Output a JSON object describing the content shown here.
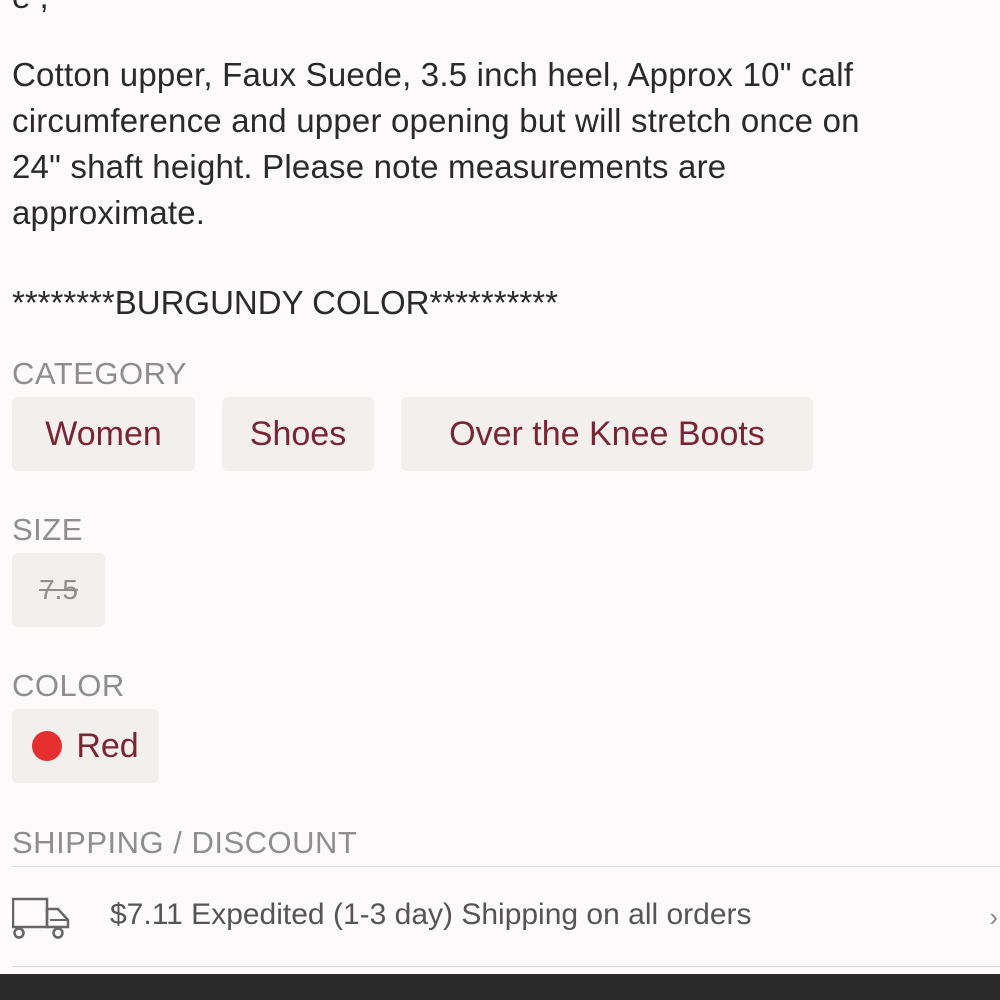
{
  "description": {
    "partial_line": "e  ,",
    "lines": [
      "Cotton upper, Faux Suede, 3.5 inch heel, Approx 10\" calf",
      "circumference and upper opening but will stretch once on",
      "24\" shaft height. Please note measurements are",
      "approximate."
    ],
    "highlight": "********BURGUNDY COLOR**********"
  },
  "category": {
    "label": "CATEGORY",
    "items": [
      "Women",
      "Shoes",
      "Over the Knee Boots"
    ]
  },
  "size": {
    "label": "SIZE",
    "value": "7.5"
  },
  "color": {
    "label": "COLOR",
    "value": "Red",
    "swatch": "#e53030"
  },
  "shipping": {
    "label": "SHIPPING / DISCOUNT",
    "text": "$7.11 Expedited (1-3 day) Shipping on all orders",
    "icon": "truck-icon"
  },
  "colors": {
    "accent": "#7a2533",
    "chip_bg": "#f2efed",
    "label_gray": "#8e8e8e"
  }
}
